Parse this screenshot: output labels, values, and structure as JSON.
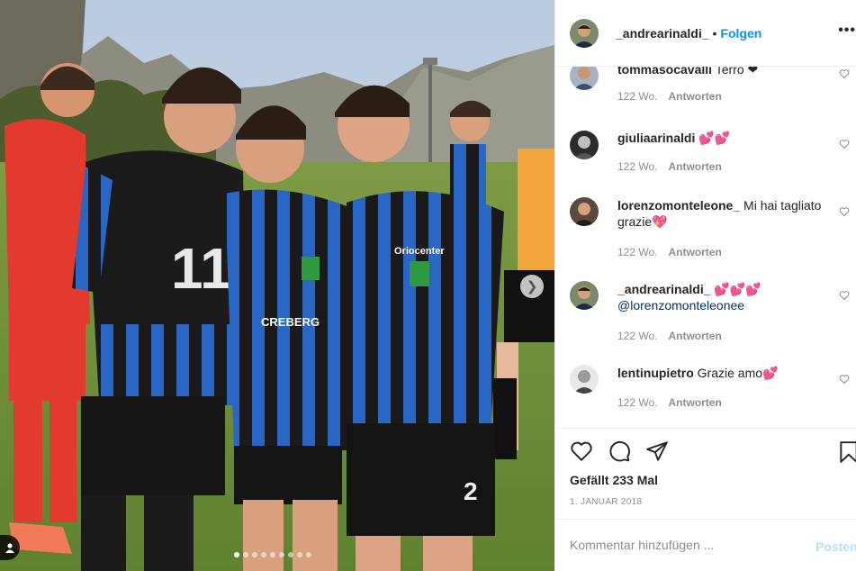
{
  "post": {
    "author": "_andrearinaldi_",
    "separator": "•",
    "follow_label": "Folgen",
    "more_label": "•••",
    "photo": {
      "carousel_total": 9,
      "carousel_active": 0,
      "scene": "Four young footballers in blue-and-black striped jerseys posing together on a pitch with mountains behind"
    },
    "comments": [
      {
        "user": "tommasocavalli",
        "text": "Terro ❤",
        "age": "122 Wo.",
        "reply_label": "Antworten"
      },
      {
        "user": "giuliaarinaldi",
        "text": "💕💕",
        "age": "122 Wo.",
        "reply_label": "Antworten"
      },
      {
        "user": "lorenzomonteleone_",
        "text": "Mi hai tagliato grazie💖",
        "age": "122 Wo.",
        "reply_label": "Antworten"
      },
      {
        "user": "_andrearinaldi_",
        "text": "💕💕💕",
        "mention": "@lorenzomonteleonee",
        "age": "122 Wo.",
        "reply_label": "Antworten"
      },
      {
        "user": "lentinupietro",
        "text": "Grazie amo💕",
        "age": "122 Wo.",
        "reply_label": "Antworten"
      }
    ],
    "likes_text": "Gefällt 233 Mal",
    "date_text": "1. JANUAR 2018",
    "comment_placeholder": "Kommentar hinzufügen ...",
    "post_label": "Posten",
    "icons": {
      "like": "heart-outline-icon",
      "comment": "speech-bubble-icon",
      "share": "paper-plane-icon",
      "save": "bookmark-icon",
      "next": "chevron-right-icon",
      "tag": "person-tag-icon"
    },
    "colors": {
      "accent": "#0095f6",
      "post_disabled": "#b2dffc",
      "muted": "#8e8e8e",
      "border": "#efefef"
    }
  }
}
